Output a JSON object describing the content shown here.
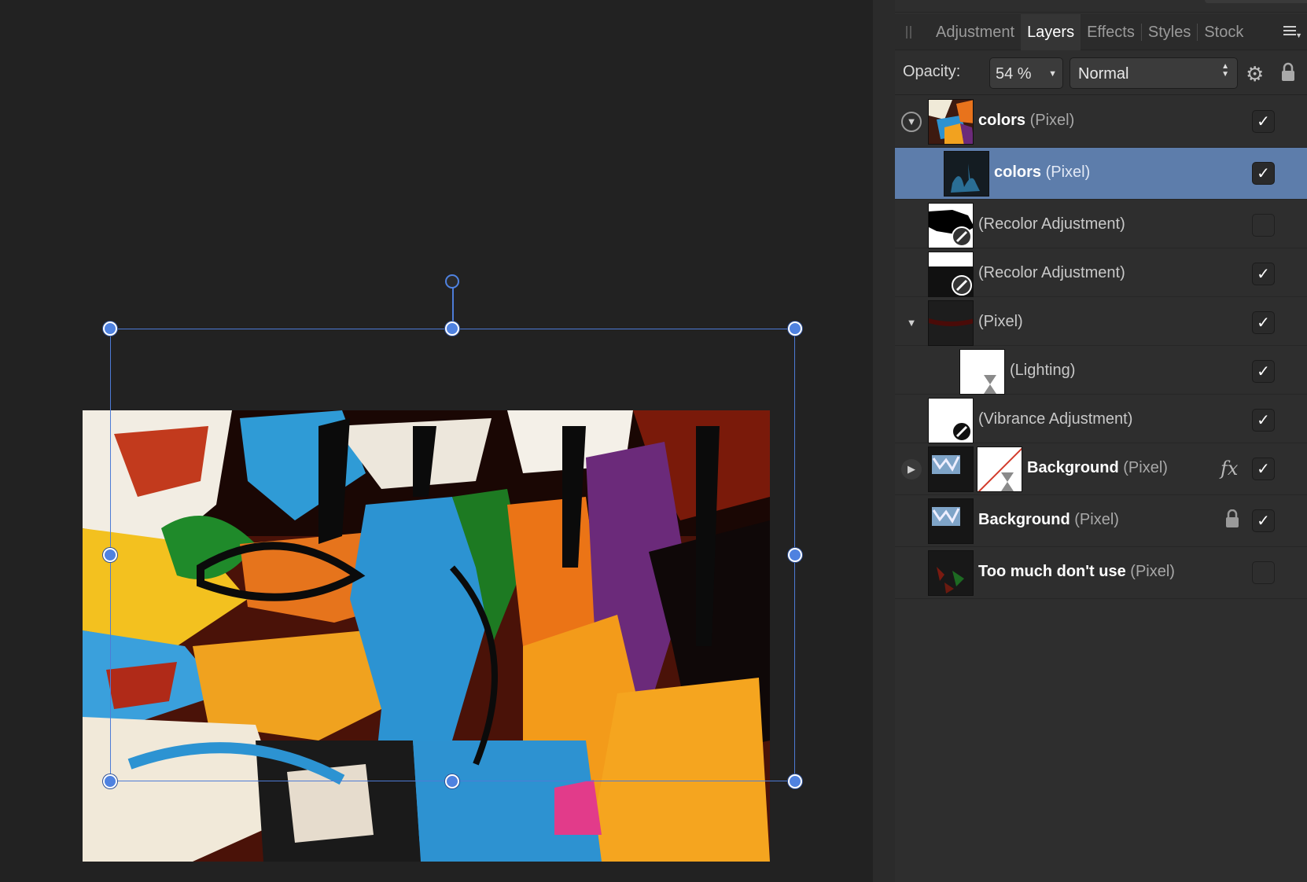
{
  "panel": {
    "tabs": [
      {
        "label": "Adjustment"
      },
      {
        "label": "Layers"
      },
      {
        "label": "Effects"
      },
      {
        "label": "Styles"
      },
      {
        "label": "Stock"
      }
    ],
    "active_tab": "Layers",
    "opacity_label": "Opacity:",
    "opacity_value": "54 %",
    "blend_mode": "Normal"
  },
  "layers": [
    {
      "name": "colors",
      "kind": "(Pixel)",
      "visible": true,
      "expanded": true,
      "selected": false
    },
    {
      "name": "colors",
      "kind": "(Pixel)",
      "visible": true,
      "selected": true
    },
    {
      "name": "",
      "kind": "(Recolor Adjustment)",
      "visible": false
    },
    {
      "name": "",
      "kind": "(Recolor Adjustment)",
      "visible": true
    },
    {
      "name": "",
      "kind": "(Pixel)",
      "visible": true,
      "expanded": true
    },
    {
      "name": "",
      "kind": "(Lighting)",
      "visible": true
    },
    {
      "name": "",
      "kind": "(Vibrance Adjustment)",
      "visible": true
    },
    {
      "name": "Background",
      "kind": "(Pixel)",
      "visible": true,
      "has_fx": true,
      "fx_label": "fx"
    },
    {
      "name": "Background",
      "kind": "(Pixel)",
      "visible": true,
      "locked": true
    },
    {
      "name": "Too much don't use",
      "kind": "(Pixel)",
      "visible": false
    }
  ],
  "check_glyph": "✓",
  "colors": {
    "selection": "#4f82e0",
    "selected_row": "#5d7dab",
    "panel_bg": "#2e2e2e",
    "canvas_bg": "#222222"
  }
}
